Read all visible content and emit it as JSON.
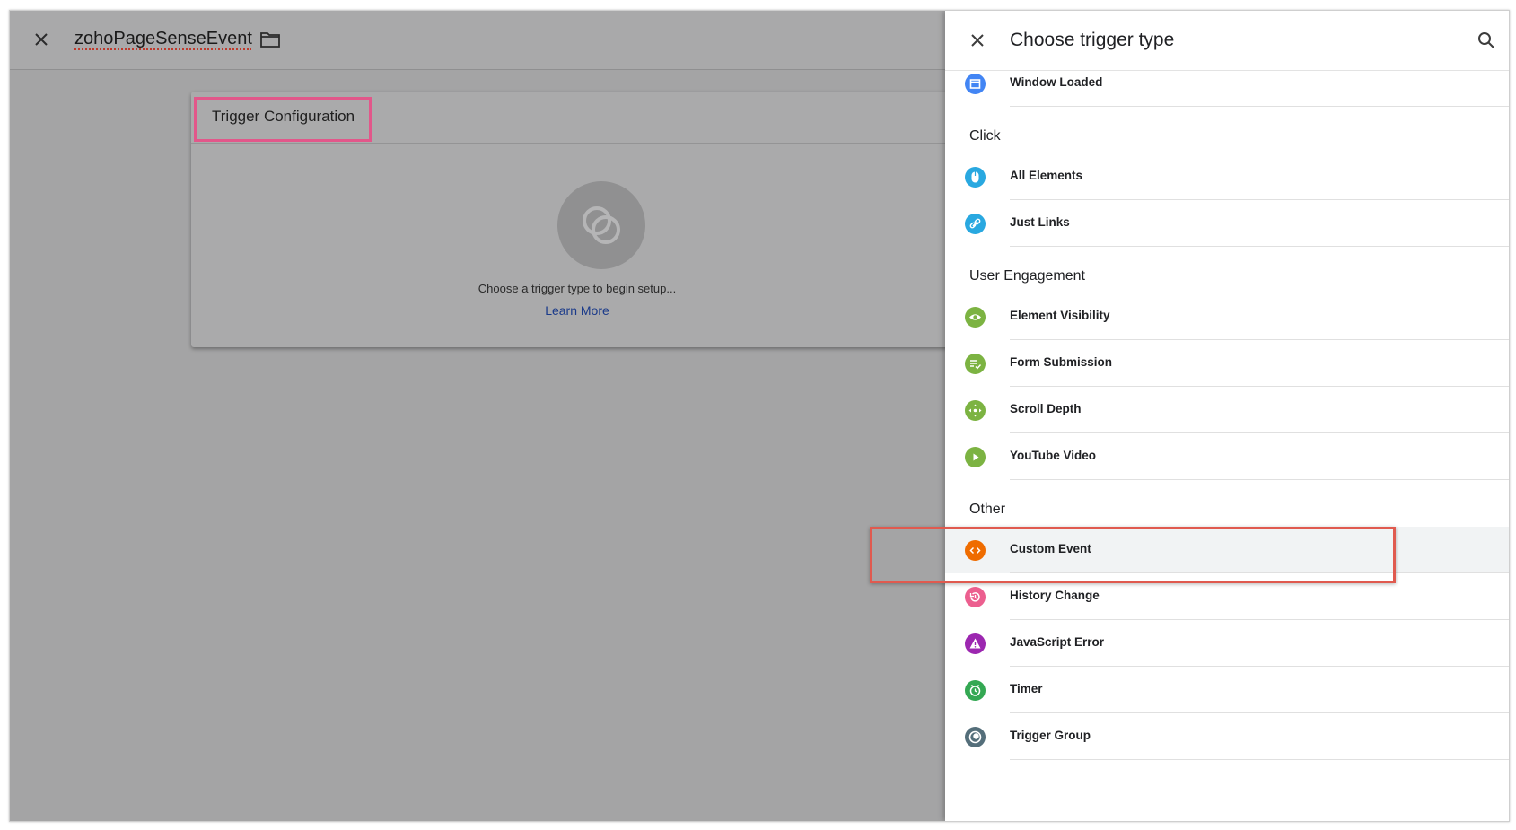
{
  "editor": {
    "tag_name": "zohoPageSenseEvent",
    "card_title": "Trigger Configuration",
    "placeholder_text": "Choose a trigger type to begin setup...",
    "learn_more": "Learn More"
  },
  "panel": {
    "title": "Choose trigger type",
    "items_top": [
      {
        "label": "Window Loaded",
        "icon": "window-icon",
        "color": "#4285f4"
      }
    ],
    "sections": [
      {
        "title": "Click",
        "items": [
          {
            "label": "All Elements",
            "icon": "mouse-icon",
            "color": "#29a8e0"
          },
          {
            "label": "Just Links",
            "icon": "link-icon",
            "color": "#29a8e0"
          }
        ]
      },
      {
        "title": "User Engagement",
        "items": [
          {
            "label": "Element Visibility",
            "icon": "eye-icon",
            "color": "#7cb342"
          },
          {
            "label": "Form Submission",
            "icon": "form-icon",
            "color": "#7cb342"
          },
          {
            "label": "Scroll Depth",
            "icon": "scroll-icon",
            "color": "#7cb342"
          },
          {
            "label": "YouTube Video",
            "icon": "play-icon",
            "color": "#7cb342"
          }
        ]
      },
      {
        "title": "Other",
        "items": [
          {
            "label": "Custom Event",
            "icon": "code-icon",
            "color": "#ef6c00"
          },
          {
            "label": "History Change",
            "icon": "history-icon",
            "color": "#ec5f8f"
          },
          {
            "label": "JavaScript Error",
            "icon": "warning-icon",
            "color": "#9c27b0"
          },
          {
            "label": "Timer",
            "icon": "timer-icon",
            "color": "#34a853"
          },
          {
            "label": "Trigger Group",
            "icon": "trigger-group-icon",
            "color": "#546e7a"
          }
        ]
      }
    ]
  }
}
